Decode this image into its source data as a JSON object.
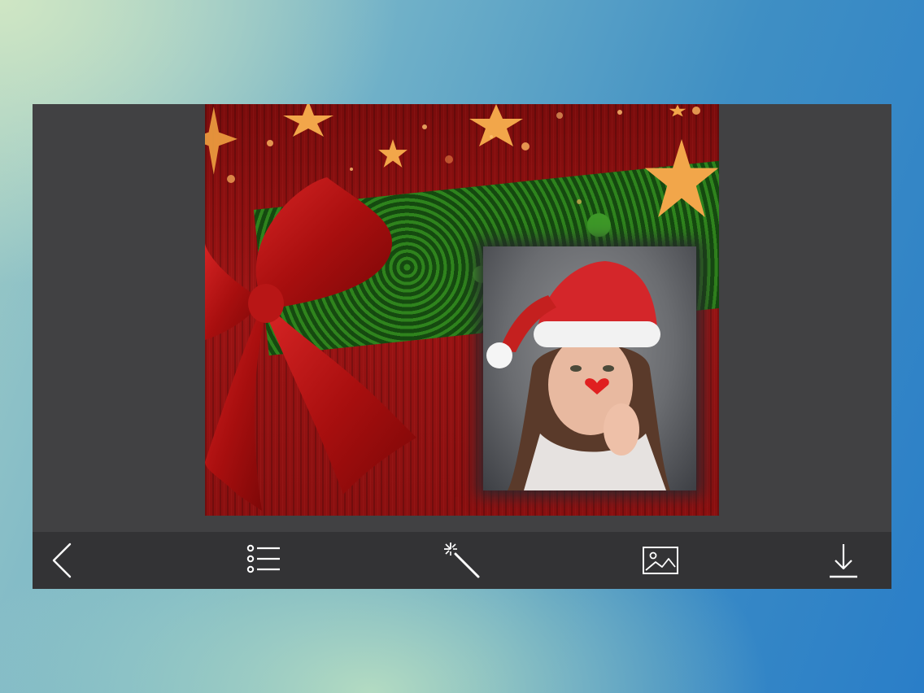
{
  "app": {
    "canvas": {
      "template": "christmas-gift-frame",
      "photo_subject": "woman-in-santa-hat"
    },
    "toolbar": {
      "buttons": [
        {
          "id": "back",
          "icon": "back-chevron-icon"
        },
        {
          "id": "frames",
          "icon": "list-icon"
        },
        {
          "id": "effects",
          "icon": "magic-wand-icon"
        },
        {
          "id": "gallery",
          "icon": "image-icon"
        },
        {
          "id": "save",
          "icon": "download-icon"
        }
      ],
      "icon_color": "#ffffff",
      "background": "#333335"
    },
    "colors": {
      "frame_background": "#414143",
      "gift_red": "#9c1414",
      "ribbon_green": "#1c6a16",
      "star_gold": "#f2a64a"
    }
  }
}
